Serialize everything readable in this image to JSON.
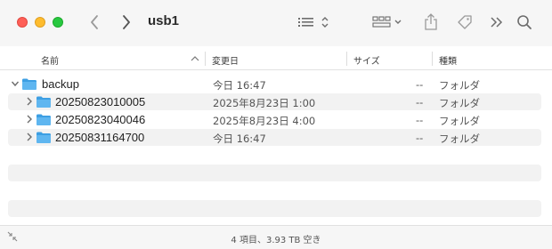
{
  "window": {
    "title": "usb1"
  },
  "toolbar": {
    "icons": [
      "back-icon",
      "forward-icon",
      "list-view-icon",
      "group-icon",
      "share-icon",
      "tag-icon",
      "more-icon",
      "search-icon"
    ]
  },
  "columns": {
    "name": "名前",
    "date": "変更日",
    "size": "サイズ",
    "kind": "種類"
  },
  "rows": [
    {
      "name": "backup",
      "date": "今日 16:47",
      "size": "--",
      "kind": "フォルダ",
      "expanded": true,
      "level": 0
    },
    {
      "name": "20250823010005",
      "date": "2025年8月23日 1:00",
      "size": "--",
      "kind": "フォルダ",
      "expanded": false,
      "level": 1
    },
    {
      "name": "20250823040046",
      "date": "2025年8月23日 4:00",
      "size": "--",
      "kind": "フォルダ",
      "expanded": false,
      "level": 1
    },
    {
      "name": "20250831164700",
      "date": "今日 16:47",
      "size": "--",
      "kind": "フォルダ",
      "expanded": false,
      "level": 1
    }
  ],
  "status": {
    "text": "4 項目、3.93 TB 空き"
  },
  "colors": {
    "folder": "#5fb6f0",
    "folder_dark": "#3d9fe3"
  }
}
